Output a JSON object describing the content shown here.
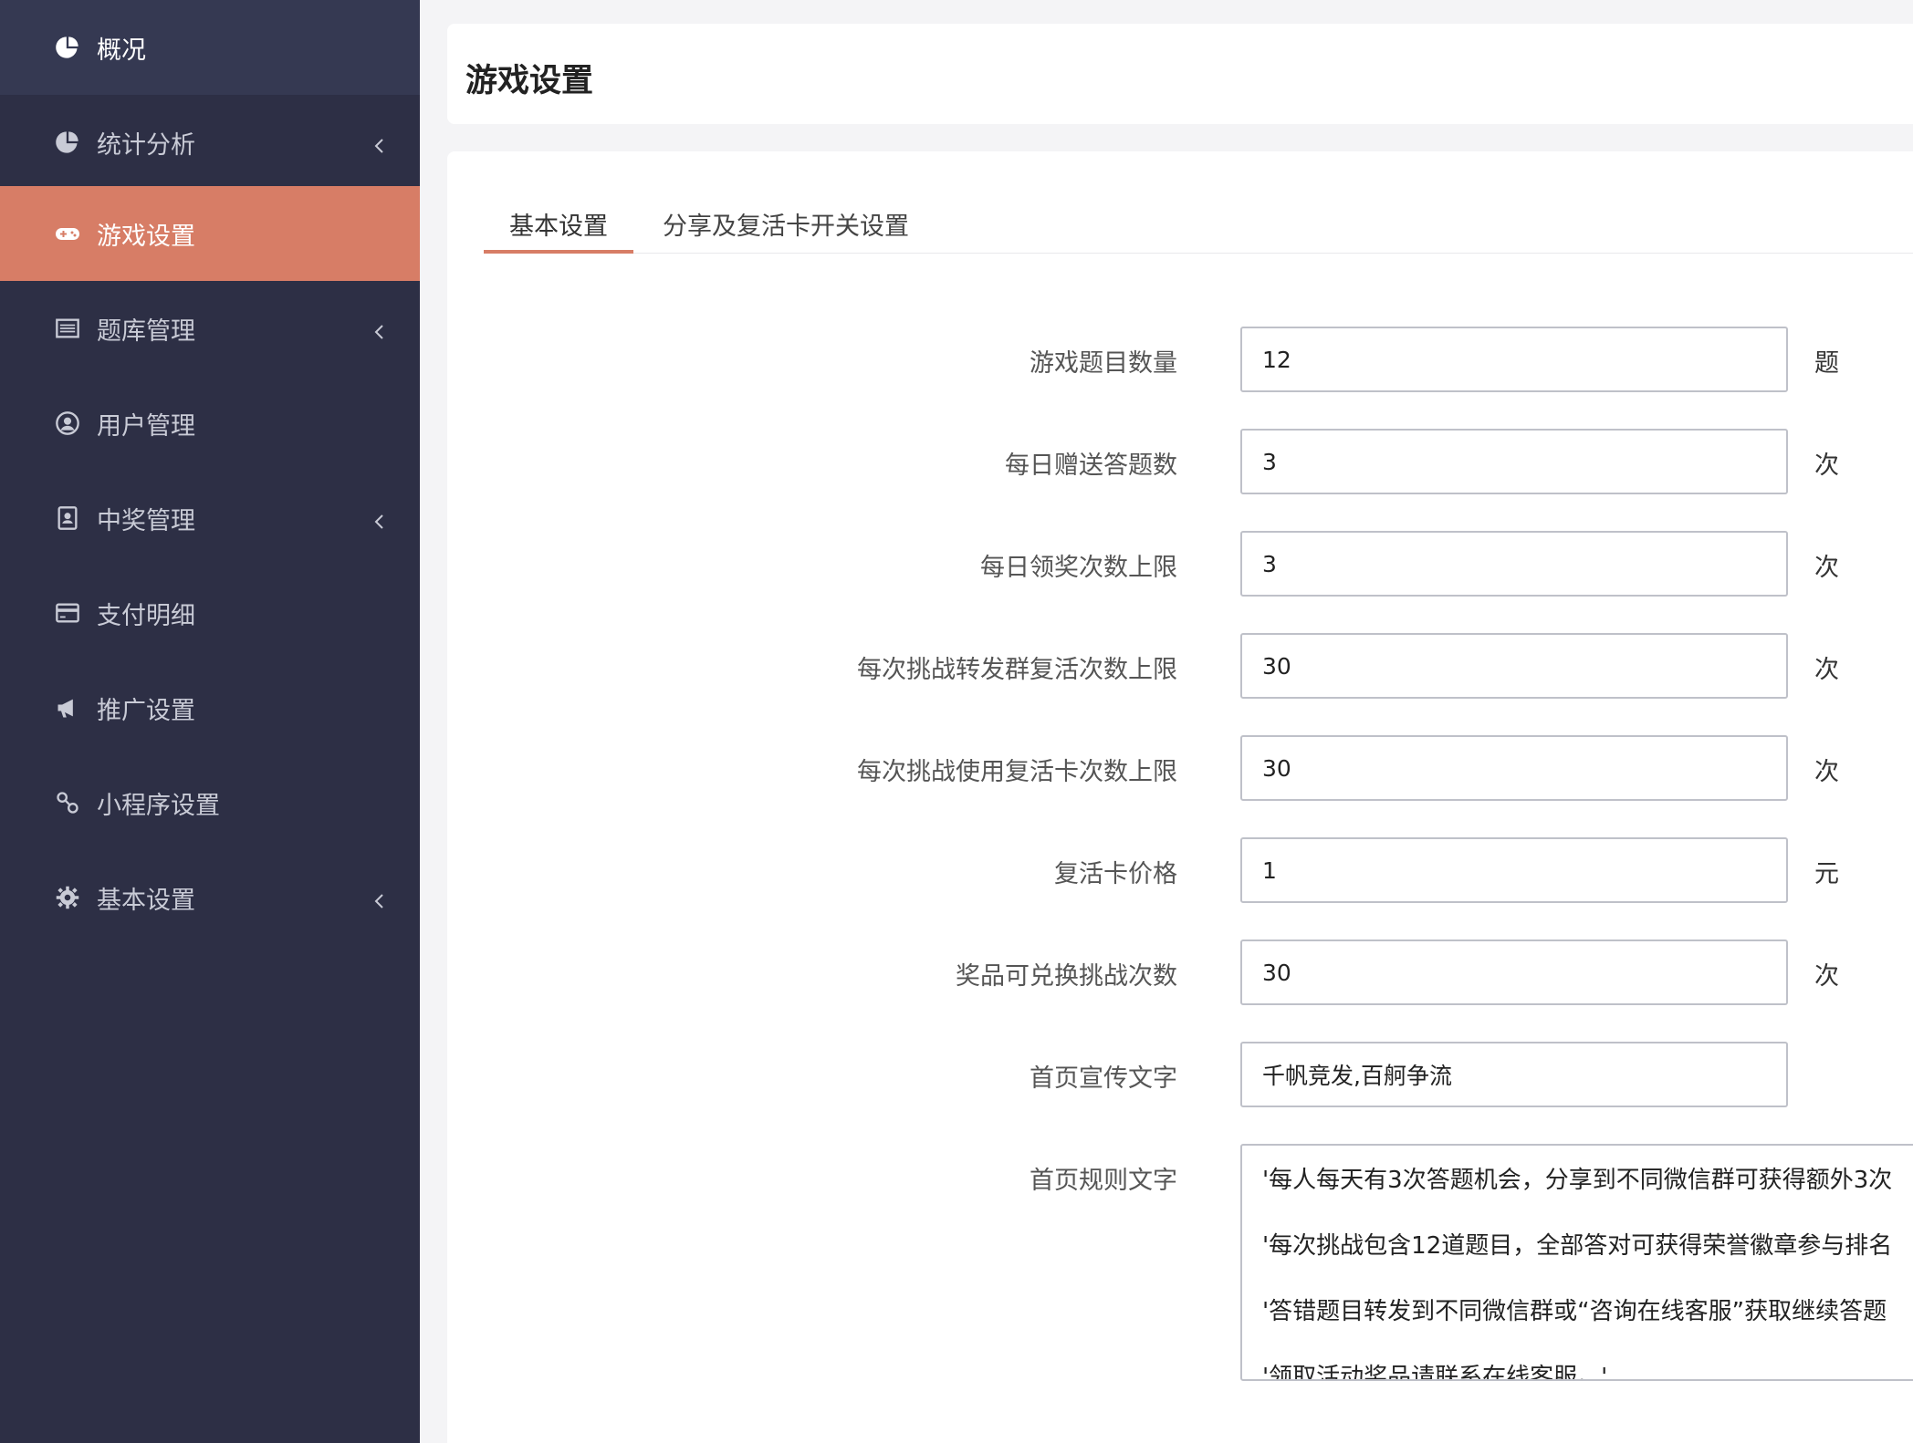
{
  "sidebar": {
    "items": [
      {
        "label": "概况",
        "icon": "pie-chart-icon",
        "has_chevron": false
      },
      {
        "label": "统计分析",
        "icon": "pie-chart-icon",
        "has_chevron": true
      },
      {
        "label": "游戏设置",
        "icon": "gamepad-icon",
        "has_chevron": false,
        "active": true
      },
      {
        "label": "题库管理",
        "icon": "list-icon",
        "has_chevron": true
      },
      {
        "label": "用户管理",
        "icon": "user-circle-icon",
        "has_chevron": false
      },
      {
        "label": "中奖管理",
        "icon": "address-book-icon",
        "has_chevron": true
      },
      {
        "label": "支付明细",
        "icon": "credit-card-icon",
        "has_chevron": false
      },
      {
        "label": "推广设置",
        "icon": "megaphone-icon",
        "has_chevron": false
      },
      {
        "label": "小程序设置",
        "icon": "link-icon",
        "has_chevron": false
      },
      {
        "label": "基本设置",
        "icon": "gear-icon",
        "has_chevron": true
      }
    ]
  },
  "header": {
    "title": "游戏设置"
  },
  "tabs": [
    {
      "label": "基本设置",
      "active": true
    },
    {
      "label": "分享及复活卡开关设置",
      "active": false
    }
  ],
  "form": {
    "fields": [
      {
        "label": "游戏题目数量",
        "value": "12",
        "unit": "题"
      },
      {
        "label": "每日赠送答题数",
        "value": "3",
        "unit": "次"
      },
      {
        "label": "每日领奖次数上限",
        "value": "3",
        "unit": "次"
      },
      {
        "label": "每次挑战转发群复活次数上限",
        "value": "30",
        "unit": "次"
      },
      {
        "label": "每次挑战使用复活卡次数上限",
        "value": "30",
        "unit": "次"
      },
      {
        "label": "复活卡价格",
        "value": "1",
        "unit": "元"
      },
      {
        "label": "奖品可兑换挑战次数",
        "value": "30",
        "unit": "次"
      },
      {
        "label": "首页宣传文字",
        "value": "千帆竞发,百舸争流",
        "unit": ""
      }
    ],
    "rules": {
      "label": "首页规则文字",
      "lines": [
        "'每人每天有3次答题机会，分享到不同微信群可获得额外3次",
        "'每次挑战包含12道题目，全部答对可获得荣誉徽章参与排名",
        "'答错题目转发到不同微信群或“咨询在线客服”获取继续答题",
        "'领取活动奖品请联系在线客服。'"
      ]
    }
  },
  "colors": {
    "sidebar_bg": "#2d2f45",
    "accent": "#d77d66"
  }
}
